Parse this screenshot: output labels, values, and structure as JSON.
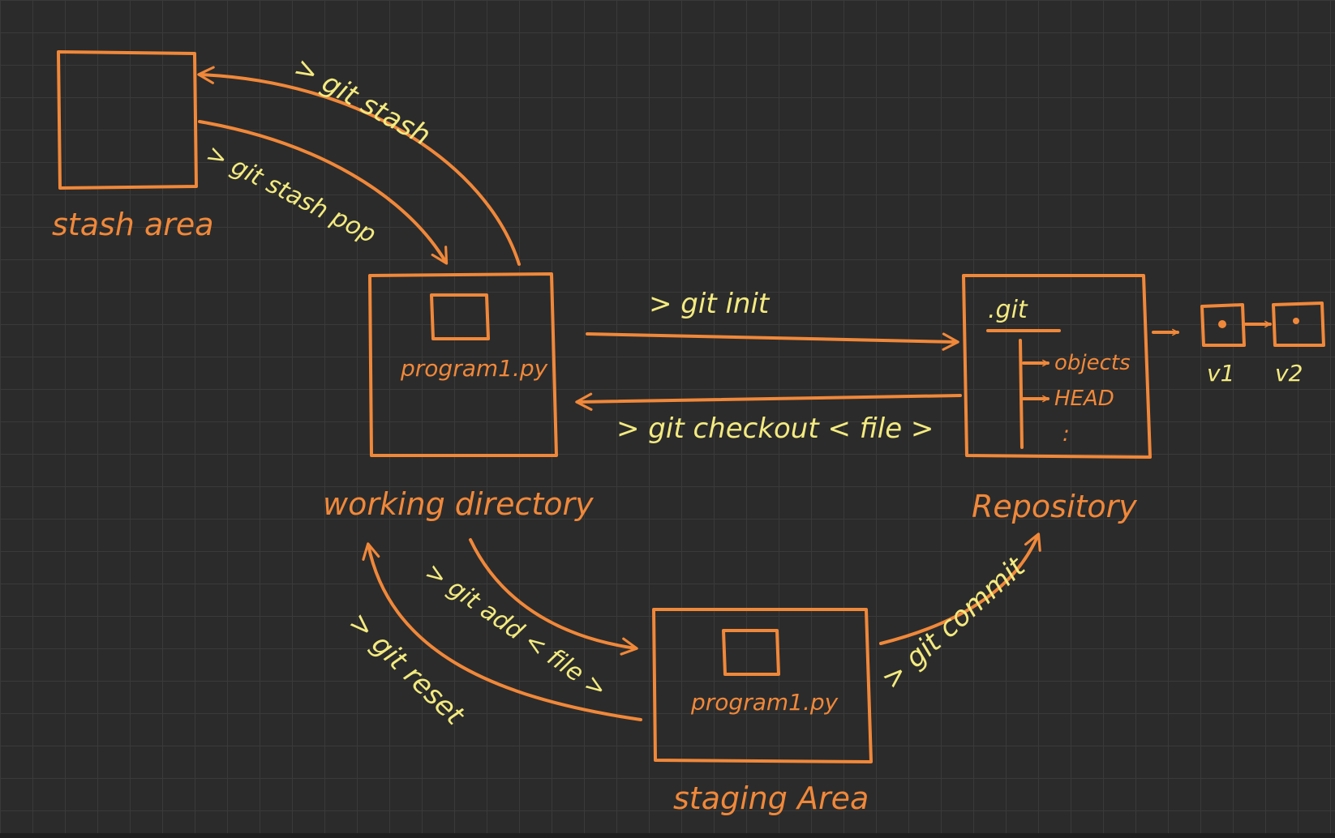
{
  "areas": {
    "stash": {
      "label": "stash area"
    },
    "working": {
      "label": "working directory",
      "file": "program1.py"
    },
    "staging": {
      "label": "staging Area",
      "file": "program1.py"
    },
    "repository": {
      "label": "Repository",
      "folder": ".git",
      "items": [
        "objects",
        "HEAD",
        ":"
      ]
    }
  },
  "commands": {
    "stash": "> git stash",
    "stash_pop": "> git stash pop",
    "init": "> git init",
    "checkout": "> git checkout < file >",
    "add": "> git add < file >",
    "reset": "> git reset",
    "commit": "> git commit"
  },
  "versions": [
    "v1",
    "v2"
  ],
  "colors": {
    "background": "#2b2b2b",
    "grid": "#3a3a3a",
    "stroke": "#f0883a",
    "command_text": "#f3ea80"
  }
}
